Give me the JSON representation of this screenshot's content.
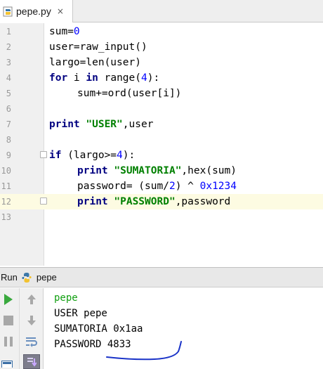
{
  "tab": {
    "file_name": "pepe.py",
    "close_glyph": "×",
    "icon": "python-file-icon"
  },
  "editor": {
    "current_line": 12,
    "lines": [
      {
        "number": "1",
        "text": "sum=0"
      },
      {
        "number": "2",
        "text": "user=raw_input()"
      },
      {
        "number": "3",
        "text": "largo=len(user)"
      },
      {
        "number": "4",
        "text": "for i in range(4):"
      },
      {
        "number": "5",
        "text": "    sum+=ord(user[i])"
      },
      {
        "number": "6",
        "text": ""
      },
      {
        "number": "7",
        "text": "print \"USER\",user"
      },
      {
        "number": "8",
        "text": ""
      },
      {
        "number": "9",
        "text": "if (largo>=4):"
      },
      {
        "number": "10",
        "text": "    print \"SUMATORIA\",hex(sum)"
      },
      {
        "number": "11",
        "text": "    password= (sum/2) ^ 0x1234"
      },
      {
        "number": "12",
        "text": "    print \"PASSWORD\",password"
      },
      {
        "number": "13",
        "text": ""
      }
    ]
  },
  "run_panel": {
    "label": "Run",
    "config_name": "pepe",
    "icon": "python-icon",
    "toolbar": {
      "run_icon": "play-icon",
      "stop_icon": "stop-icon",
      "pause_icon": "pause-icon",
      "up_icon": "arrow-up-icon",
      "down_icon": "arrow-down-icon",
      "wrap_icon": "soft-wrap-icon",
      "scroll_icon": "scroll-to-end-icon"
    },
    "output": [
      "pepe",
      "USER pepe",
      "SUMATORIA 0x1aa",
      "PASSWORD 4833"
    ]
  },
  "colors": {
    "keyword": "#000080",
    "string": "#008000",
    "number": "#0000ff",
    "console_input": "#12a012",
    "current_line": "#fdfbe2",
    "annotation_ink": "#1a33c8"
  }
}
